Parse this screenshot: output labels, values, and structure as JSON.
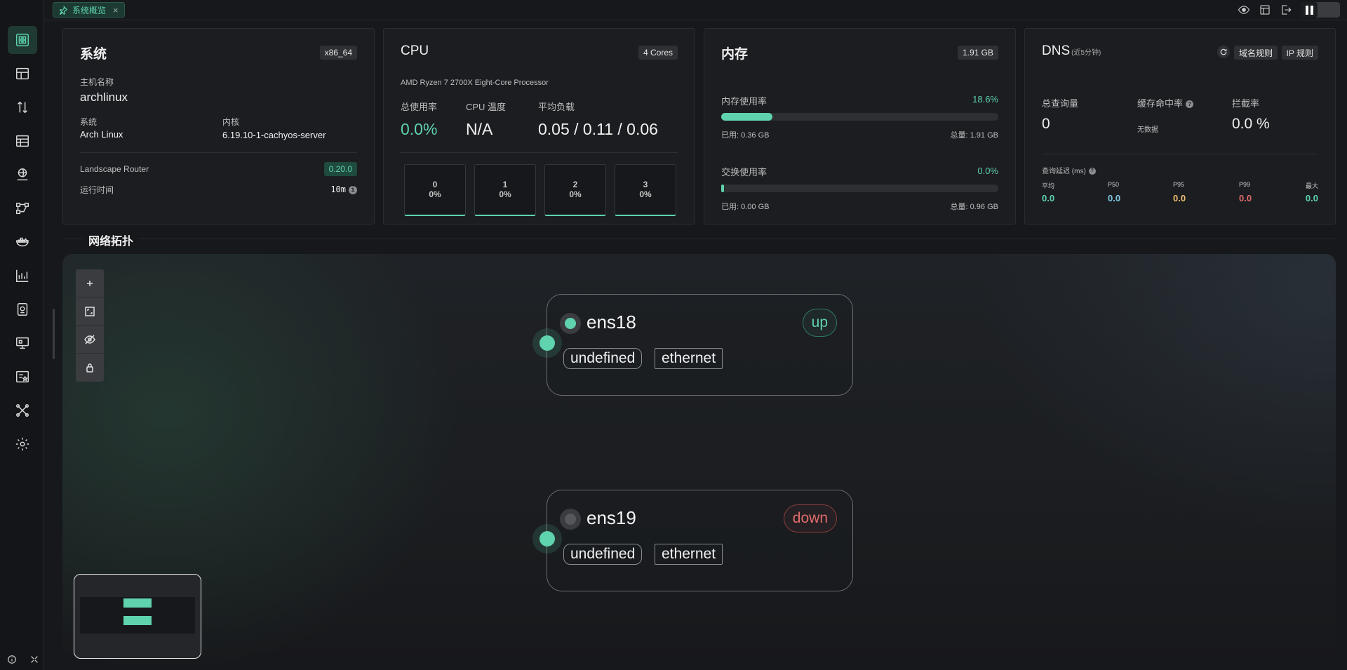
{
  "tab": {
    "label": "系统概览",
    "close": "×"
  },
  "colors": {
    "accent": "#5fd3ad",
    "down": "#e06c6c",
    "yellow": "#f0c070",
    "blue": "#7ec8e3"
  },
  "system": {
    "title": "系统",
    "arch": "x86_64",
    "hostname_label": "主机名称",
    "hostname": "archlinux",
    "os_label": "系统",
    "os": "Arch Linux",
    "kernel_label": "内核",
    "kernel": "6.19.10-1-cachyos-server",
    "router_label": "Landscape Router",
    "router_version": "0.20.0",
    "uptime_label": "运行时间",
    "uptime": "10m"
  },
  "cpu": {
    "title": "CPU",
    "cores_badge": "4 Cores",
    "model": "AMD Ryzen 7 2700X Eight-Core Processor",
    "usage_label": "总使用率",
    "usage": "0.0%",
    "temp_label": "CPU 温度",
    "temp": "N/A",
    "load_label": "平均负载",
    "load": "0.05 / 0.11 / 0.06",
    "cores": [
      {
        "id": "0",
        "usage": "0%"
      },
      {
        "id": "1",
        "usage": "0%"
      },
      {
        "id": "2",
        "usage": "0%"
      },
      {
        "id": "3",
        "usage": "0%"
      }
    ]
  },
  "memory": {
    "title": "内存",
    "total_badge": "1.91 GB",
    "mem_label": "内存使用率",
    "mem_pct": "18.6%",
    "mem_fraction": 0.186,
    "mem_used": "已用: 0.36 GB",
    "mem_total": "总量: 1.91 GB",
    "swap_label": "交换使用率",
    "swap_pct": "0.0%",
    "swap_fraction": 0.0,
    "swap_used": "已用: 0.00 GB",
    "swap_total": "总量: 0.96 GB"
  },
  "dns": {
    "title": "DNS",
    "subtitle": "(近5分钟)",
    "domain_rules": "域名规则",
    "ip_rules": "IP 规则",
    "queries_label": "总查询量",
    "queries": "0",
    "cache_label": "缓存命中率",
    "cache": "无数据",
    "block_label": "拦截率",
    "block": "0.0 %",
    "latency_label": "查询延迟 (ms)",
    "latency": [
      {
        "label": "平均",
        "value": "0.0"
      },
      {
        "label": "P50",
        "value": "0.0"
      },
      {
        "label": "P95",
        "value": "0.0"
      },
      {
        "label": "P99",
        "value": "0.0"
      },
      {
        "label": "最大",
        "value": "0.0"
      }
    ]
  },
  "topology": {
    "title": "网络拓扑",
    "nodes": [
      {
        "name": "ens18",
        "state": "up",
        "tag1": "undefined",
        "tag2": "ethernet"
      },
      {
        "name": "ens19",
        "state": "down",
        "tag1": "undefined",
        "tag2": "ethernet"
      }
    ]
  }
}
